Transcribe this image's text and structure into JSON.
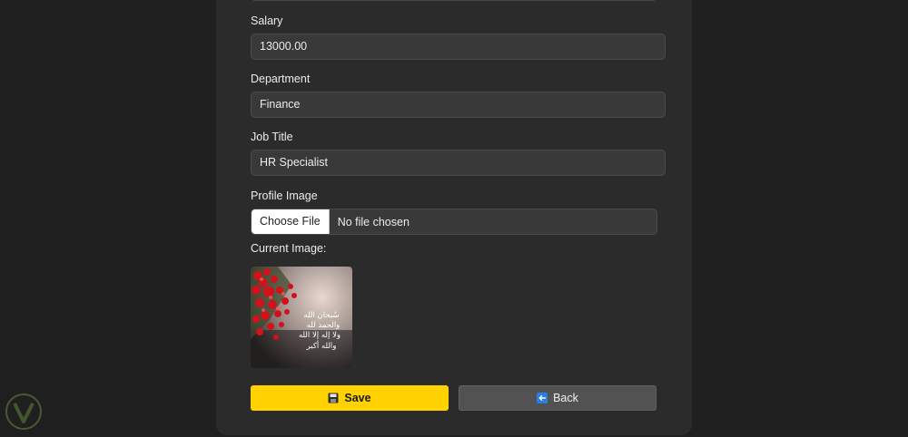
{
  "form": {
    "salary": {
      "label": "Salary",
      "value": "13000.00"
    },
    "department": {
      "label": "Department",
      "value": "Finance"
    },
    "job_title": {
      "label": "Job Title",
      "value": "HR Specialist"
    },
    "profile_image": {
      "label": "Profile Image",
      "button_label": "Choose File",
      "status_text": "No file chosen"
    },
    "current_image_label": "Current Image:",
    "current_image_text": [
      "سُبحان الله",
      "والحمد لله",
      "ولا إله إلا الله",
      "والله أكبر"
    ]
  },
  "actions": {
    "save_label": "Save",
    "back_label": "Back"
  },
  "colors": {
    "save": "#ffd200",
    "back": "#525252",
    "card": "#2b2b2b",
    "page": "#1f1f1f"
  },
  "icons": {
    "save": "floppy-disk-icon",
    "back": "arrow-left-icon"
  }
}
